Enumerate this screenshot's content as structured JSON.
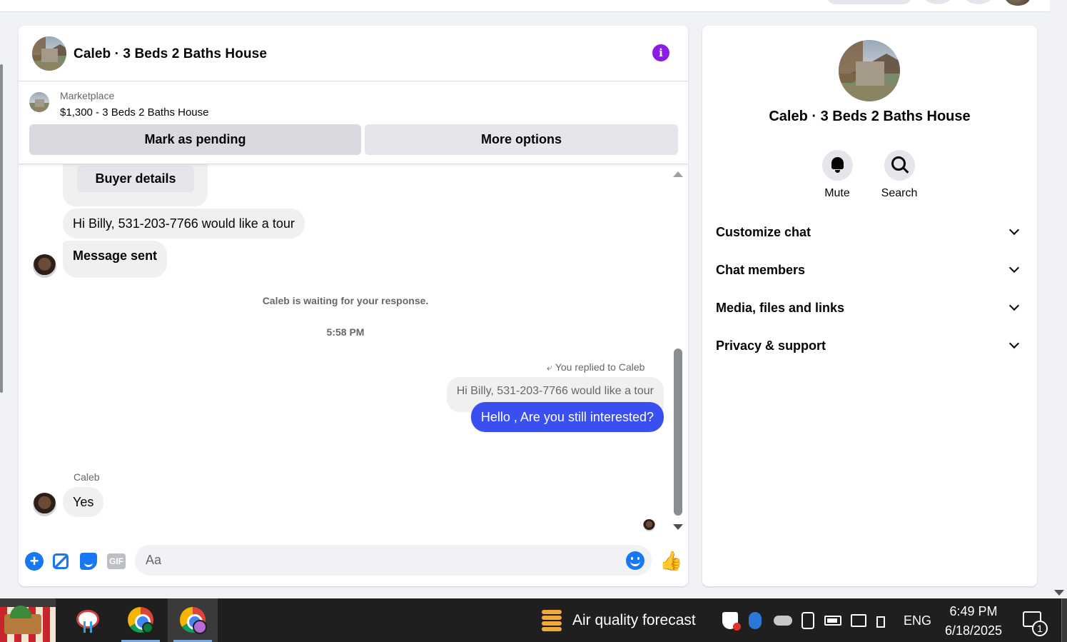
{
  "chat": {
    "title": "Caleb · 3 Beds 2 Baths House",
    "listing": {
      "source": "Marketplace",
      "price_title": "$1,300 - 3 Beds 2 Baths House",
      "mark_pending_label": "Mark as pending",
      "more_options_label": "More options"
    },
    "messages": {
      "buyer_details_label": "Buyer details",
      "tour_request": "Hi Billy, 531-203-7766 would like a tour",
      "message_sent": "Message sent",
      "waiting_status": "Caleb is waiting for your response.",
      "timestamp": "5:58 PM",
      "reply_label": "You replied to Caleb",
      "quoted_text": "Hi Billy, 531-203-7766 would like a tour",
      "my_message": "Hello , Are you still interested?",
      "sender_name": "Caleb",
      "reply_yes": "Yes"
    },
    "composer": {
      "placeholder": "Aa",
      "gif_label": "GIF"
    }
  },
  "panel": {
    "title": "Caleb · 3 Beds 2 Baths House",
    "mute_label": "Mute",
    "search_label": "Search",
    "sections": [
      "Customize chat",
      "Chat members",
      "Media, files and links",
      "Privacy & support"
    ]
  },
  "taskbar": {
    "weather_text": "Air quality forecast",
    "language": "ENG",
    "time": "6:49 PM",
    "date": "6/18/2025",
    "notification_count": "1"
  },
  "colors": {
    "accent": "#1877f2",
    "my_bubble": "#3a4ff0",
    "info": "#8a1ee6"
  }
}
